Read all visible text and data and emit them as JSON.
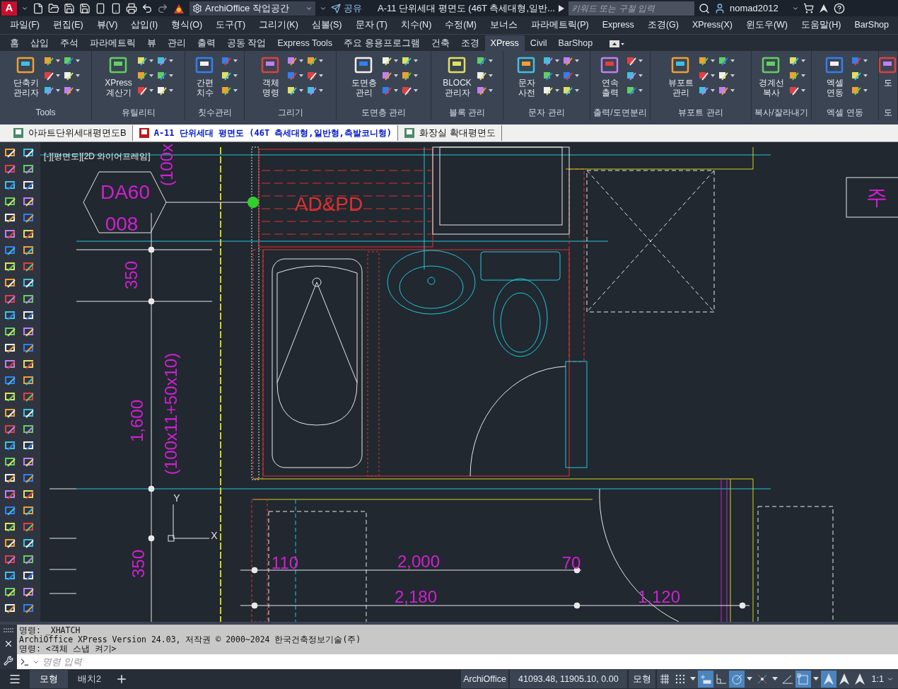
{
  "title_bar": {
    "logo_letter": "A",
    "workspace": "ArchiOffice 작업공간",
    "share": "공유",
    "title": "A-11 단위세대 평면도 (46T 측세대형,일반...",
    "search": {
      "placeholder": "키워드 또는 구절 입력"
    },
    "user": "nomad2012"
  },
  "menu": [
    "파일(F)",
    "편집(E)",
    "뷰(V)",
    "삽입(I)",
    "형식(O)",
    "도구(T)",
    "그리기(K)",
    "심볼(S)",
    "문자 (T)",
    "치수(N)",
    "수정(M)",
    "보너스",
    "파라메트릭(P)",
    "Express",
    "조경(G)",
    "XPress(X)",
    "윈도우(W)",
    "도움말(H)",
    "BarShop"
  ],
  "ribbon_tabs": [
    {
      "label": "홈",
      "selected": false
    },
    {
      "label": "삽입",
      "selected": false
    },
    {
      "label": "주석",
      "selected": false
    },
    {
      "label": "파라메트릭",
      "selected": false
    },
    {
      "label": "뷰",
      "selected": false
    },
    {
      "label": "관리",
      "selected": false
    },
    {
      "label": "출력",
      "selected": false
    },
    {
      "label": "공동 작업",
      "selected": false
    },
    {
      "label": "Express Tools",
      "selected": false
    },
    {
      "label": "주요 응용프로그램",
      "selected": false
    },
    {
      "label": "건축",
      "selected": false
    },
    {
      "label": "조경",
      "selected": false
    },
    {
      "label": "XPress",
      "selected": true
    },
    {
      "label": "Civil",
      "selected": false
    },
    {
      "label": "BarShop",
      "selected": false
    }
  ],
  "ribbon_panels": [
    {
      "label": "Tools",
      "button": [
        "단축키",
        "관리자"
      ]
    },
    {
      "label": "유틸리티",
      "button": [
        "XPress",
        "계산기"
      ]
    },
    {
      "label": "칫수관리",
      "button": [
        "간편",
        "치수"
      ]
    },
    {
      "label": "그리기",
      "button": [
        "객체",
        "명령"
      ]
    },
    {
      "label": "도면층 관리",
      "button": [
        "도면층",
        "관리"
      ]
    },
    {
      "label": "블록 관리",
      "button": [
        "BLOCK",
        "관리자"
      ]
    },
    {
      "label": "문자 관리",
      "button": [
        "문자",
        "사전"
      ]
    },
    {
      "label": "출력/도면분리",
      "button": [
        "연속",
        "출력"
      ]
    },
    {
      "label": "뷰포트 관리",
      "button": [
        "뷰포트",
        "관리"
      ]
    },
    {
      "label": "복사/잘라내기",
      "button": [
        "경계선",
        "복사"
      ]
    },
    {
      "label": "엑셀 연동",
      "button": [
        "엑셀",
        "연동"
      ]
    },
    {
      "label": "도",
      "button": [
        "도"
      ]
    }
  ],
  "document_tabs": [
    {
      "label": "아파트단위세대평면도B",
      "selected": false
    },
    {
      "label": "A-11 단위세대 평면도 (46T 측세대형,일반형,측발코니형)",
      "selected": true
    },
    {
      "label": "화장실 확대평면도",
      "selected": false
    }
  ],
  "viewport_label": "[-][평면도][2D 와이어프레임]",
  "drawing_labels": [
    "DA60",
    "008",
    "(100x",
    "AD&PD",
    "350",
    "1,600",
    "(100x11+50x10)",
    "350",
    "110",
    "2,000",
    "70",
    "2,180",
    "1,120",
    "Y",
    "X",
    "주"
  ],
  "command_line": {
    "history": [
      "명령: _XHATCH",
      "ArchiOffice XPress Version 24.03, 저작권 © 2000~2024 한국건축정보기술(주)",
      "명령:  <객체 스냅 켜기>"
    ],
    "placeholder": "명령 입력"
  },
  "layout_tabs": [
    {
      "label": "모형",
      "selected": true
    },
    {
      "label": "배치2",
      "selected": false
    }
  ],
  "status_bar": {
    "app": "ArchiOffice",
    "coordinates": "41093.48, 11905.10, 0.00",
    "space": "모형",
    "scale": "1:1",
    "toggles": [
      {
        "kind": "grid",
        "on": false
      },
      {
        "kind": "snap",
        "on": false
      },
      {
        "kind": "dropdown"
      },
      {
        "kind": "infer",
        "on": true
      },
      {
        "kind": "ortho",
        "on": false
      },
      {
        "kind": "polar",
        "on": true
      },
      {
        "kind": "dropdown"
      },
      {
        "kind": "osnap",
        "on": false
      },
      {
        "kind": "dropdown"
      },
      {
        "kind": "angle",
        "on": false
      },
      {
        "kind": "select",
        "on": true
      },
      {
        "kind": "dropdown"
      },
      {
        "kind": "annotate",
        "on": true
      },
      {
        "kind": "annotate-auto",
        "on": false
      },
      {
        "kind": "annotate-scale",
        "on": false
      }
    ]
  }
}
